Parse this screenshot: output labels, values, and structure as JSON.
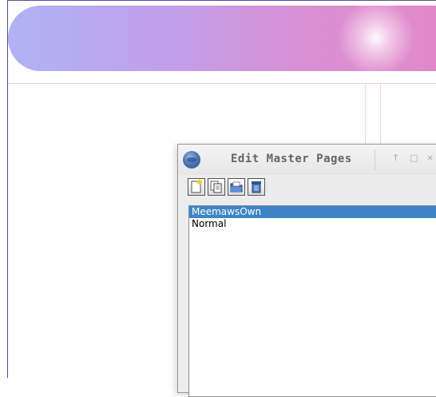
{
  "dialog": {
    "title": "Edit Master Pages",
    "window_controls": {
      "up_icon": "↑",
      "maximize_icon": "□",
      "close_icon": "×"
    },
    "toolbar": {
      "buttons": [
        {
          "name": "new-master-page",
          "icon": "new-page-icon"
        },
        {
          "name": "duplicate-master-page",
          "icon": "duplicate-icon"
        },
        {
          "name": "import-master-page",
          "icon": "folder-icon"
        },
        {
          "name": "delete-master-page",
          "icon": "trash-icon"
        }
      ]
    },
    "master_pages": [
      {
        "label": "MeemawsOwn",
        "selected": true
      },
      {
        "label": "Normal",
        "selected": false
      }
    ]
  },
  "colors": {
    "selection": "#3d84c8",
    "banner_start": "#b0b3f5",
    "banner_end": "#e387c8",
    "guide": "#f2d3dc"
  }
}
